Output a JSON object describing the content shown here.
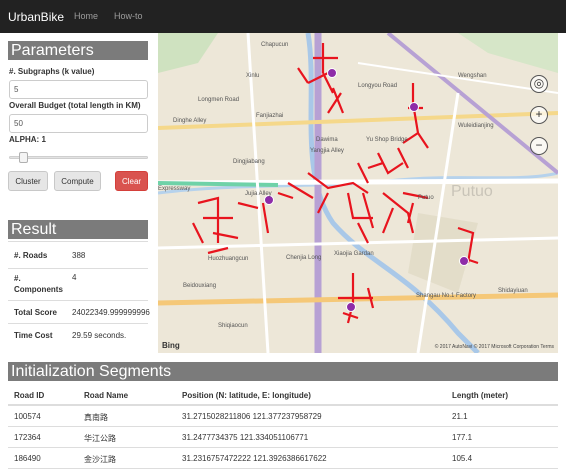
{
  "nav": {
    "brand": "UrbanBike",
    "home": "Home",
    "howto": "How-to"
  },
  "parameters": {
    "title": "Parameters",
    "k_label": "#. Subgraphs (k value)",
    "k_value": "5",
    "budget_label": "Overall Budget (total length in KM)",
    "budget_value": "50",
    "alpha_label": "ALPHA: 1",
    "alpha_fraction": 0.07,
    "cluster_label": "Cluster",
    "compute_label": "Compute",
    "clear_label": "Clear"
  },
  "result": {
    "title": "Result",
    "rows": [
      {
        "key": "#. Roads",
        "value": "388"
      },
      {
        "key": "#. Components",
        "value": "4"
      },
      {
        "key": "Total Score",
        "value": "24022349.999999996"
      },
      {
        "key": "Time Cost",
        "value": "29.59 seconds."
      }
    ]
  },
  "map": {
    "labels": [
      "Chapucun",
      "Xinlu",
      "Longmen Road",
      "Dinghe Alley",
      "Fanjiazhai",
      "Dingjiabang",
      "Yangjia Alley",
      "Jujia Alley",
      "Huozhuangcun",
      "Chenjia Long",
      "Beidouxiang",
      "Shiqiaocun",
      "Xiaojia Gardan",
      "Shangau No.1 Factory",
      "Shidayiuan",
      "Putuo",
      "Yu Shop Bridge",
      "Dawima",
      "Expressway",
      "Wuleidianjing",
      "Longyou Road",
      "Wengshan"
    ],
    "bing": "Bing",
    "copyright": "© 2017 AutoNavi © 2017 Microsoft Corporation Terms",
    "putuo_big": "Putuo",
    "zoom_in": "+",
    "zoom_out": "−",
    "locate": "◎",
    "road_color": "#e8141e",
    "node_color": "#8e2ca8"
  },
  "segments": {
    "title": "Initialization Segments",
    "columns": [
      "Road ID",
      "Road Name",
      "Position (N: latitude, E: longitude)",
      "Length (meter)"
    ],
    "rows": [
      [
        "100574",
        "真南路",
        "31.2715028211806 121.377237958729",
        "21.1"
      ],
      [
        "172364",
        "华江公路",
        "31.2477734375 121.334051106771",
        "177.1"
      ],
      [
        "186490",
        "金沙江路",
        "31.2316757472222 121.3926386617622",
        "105.4"
      ]
    ]
  }
}
